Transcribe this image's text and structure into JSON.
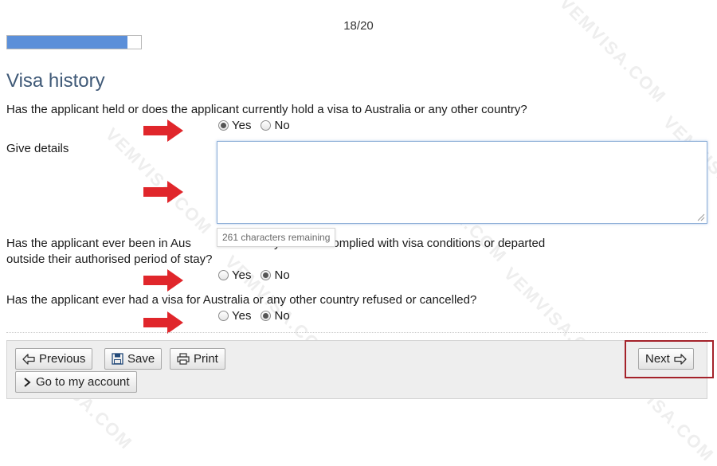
{
  "header": {
    "step_counter": "18/20",
    "progress_fraction": 0.9
  },
  "page_title": "Visa history",
  "questions": [
    {
      "text": "Has the applicant held or does the applicant currently hold a visa to Australia or any other country?",
      "options": [
        "Yes",
        "No"
      ],
      "selected": "Yes"
    },
    {
      "text_line1": "Has the applicant ever been in Aus",
      "text_line1_end": "try and not complied with visa conditions or departed",
      "text_line2": "outside their authorised period of stay?",
      "options": [
        "Yes",
        "No"
      ],
      "selected": "No"
    },
    {
      "text": "Has the applicant ever had a visa for Australia or any other country refused or cancelled?",
      "options": [
        "Yes",
        "No"
      ],
      "selected": "No"
    }
  ],
  "details": {
    "label": "Give details",
    "value": "",
    "chars_remaining": "261 characters remaining"
  },
  "footer": {
    "previous_label": "Previous",
    "save_label": "Save",
    "print_label": "Print",
    "account_label": "Go to my account",
    "next_label": "Next"
  },
  "watermark": "VEMVISA.COM",
  "colors": {
    "progress_fill": "#5b8fd9",
    "title": "#3f5977",
    "arrow": "#e0262b",
    "highlight": "#a4222a"
  },
  "icons": [
    "arrow-left-icon",
    "save-disk-icon",
    "printer-icon",
    "chevron-right-icon",
    "arrow-right-icon",
    "red-pointer-arrow-icon"
  ]
}
